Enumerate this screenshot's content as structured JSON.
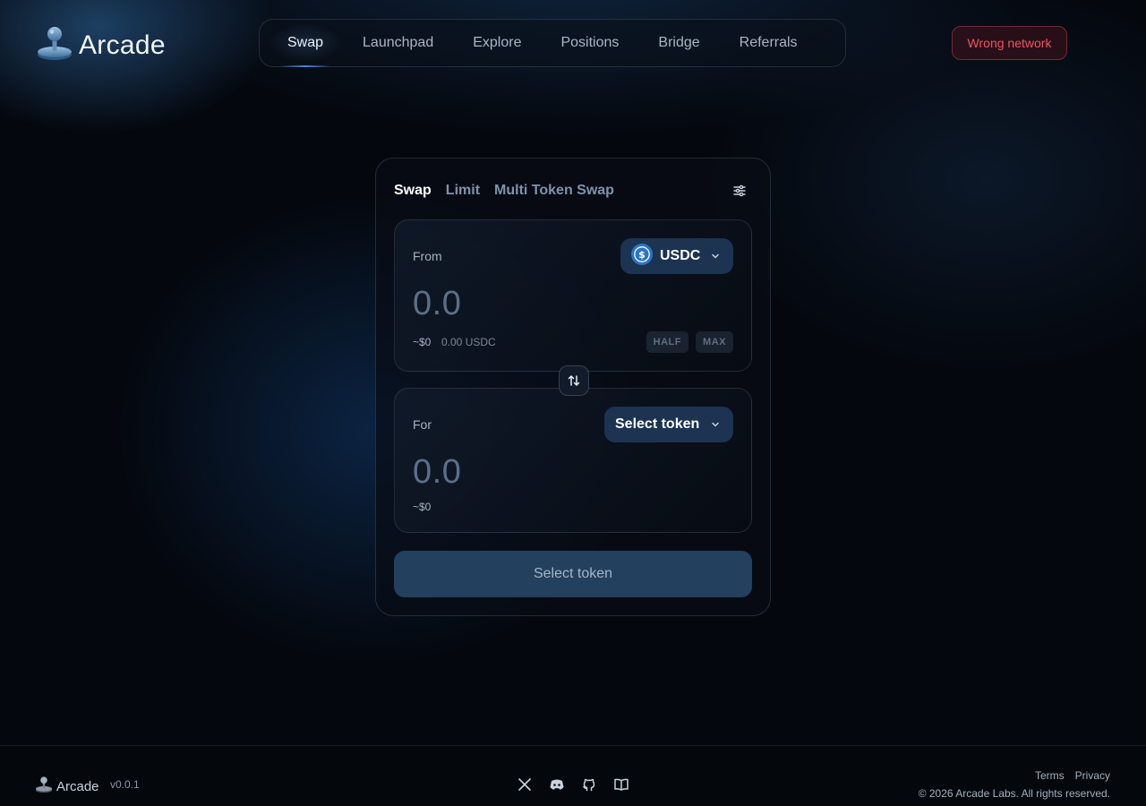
{
  "brand": {
    "name": "Arcade",
    "icon": "joystick-icon"
  },
  "nav": {
    "items": [
      {
        "label": "Swap",
        "active": true
      },
      {
        "label": "Launchpad"
      },
      {
        "label": "Explore"
      },
      {
        "label": "Positions"
      },
      {
        "label": "Bridge"
      },
      {
        "label": "Referrals"
      }
    ]
  },
  "network": {
    "status_label": "Wrong network",
    "color": "#f05561"
  },
  "swap": {
    "tabs": [
      {
        "label": "Swap",
        "active": true
      },
      {
        "label": "Limit"
      },
      {
        "label": "Multi Token Swap"
      }
    ],
    "settings_icon": "sliders-icon",
    "from": {
      "label": "From",
      "token": "USDC",
      "token_icon": "usdc-icon",
      "amount": "0.0",
      "usd": "~$0",
      "balance": "0.00 USDC",
      "half_label": "HALF",
      "max_label": "MAX"
    },
    "flip_icon": "swap-arrows-icon",
    "to": {
      "label": "For",
      "token": "Select token",
      "amount": "0.0",
      "usd": "~$0"
    },
    "cta_label": "Select token"
  },
  "footer": {
    "brand": "Arcade",
    "version": "v0.0.1",
    "socials": [
      "x-icon",
      "discord-icon",
      "github-icon",
      "docs-book-icon"
    ],
    "links": [
      "Terms",
      "Privacy"
    ],
    "copyright": "© 2026 Arcade Labs. All rights reserved."
  },
  "colors": {
    "accent": "#3f8ae0",
    "button_bg": "#1c3352",
    "cta_bg": "#23405f",
    "background": "#04070d"
  }
}
